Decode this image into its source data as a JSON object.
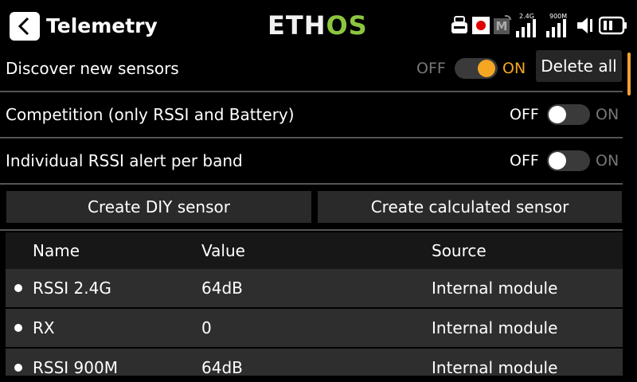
{
  "header": {
    "title": "Telemetry",
    "logo_part1": "ETH",
    "logo_part2": "OS",
    "logo_color_main": "#f2f2f2",
    "logo_color_accent": "#8cc63f",
    "status": {
      "usb_icon": "usb-icon",
      "record_icon": "record-icon",
      "record_color": "#e00000",
      "module_label": "M",
      "rf_24_label": "2.4G",
      "rf_900_label": "900M",
      "rf_24_bars": 4,
      "rf_900_bars": 4,
      "volume_icon": "speaker-icon",
      "battery_icon": "battery-icon"
    }
  },
  "settings": [
    {
      "label": "Discover new sensors",
      "off_label": "OFF",
      "on_label": "ON",
      "value": "on",
      "has_delete": true,
      "delete_label": "Delete all"
    },
    {
      "label": "Competition (only RSSI and Battery)",
      "off_label": "OFF",
      "on_label": "ON",
      "value": "off"
    },
    {
      "label": "Individual RSSI alert per band",
      "off_label": "OFF",
      "on_label": "ON",
      "value": "off"
    }
  ],
  "accent_color": "#f5a623",
  "buttons": {
    "create_diy": "Create DIY sensor",
    "create_calculated": "Create calculated sensor"
  },
  "table": {
    "columns": [
      "Name",
      "Value",
      "Source"
    ],
    "rows": [
      {
        "name": "RSSI 2.4G",
        "value": "64dB",
        "source": "Internal module"
      },
      {
        "name": "RX",
        "value": "0",
        "source": "Internal module"
      },
      {
        "name": "RSSI 900M",
        "value": "64dB",
        "source": "Internal module"
      }
    ]
  }
}
